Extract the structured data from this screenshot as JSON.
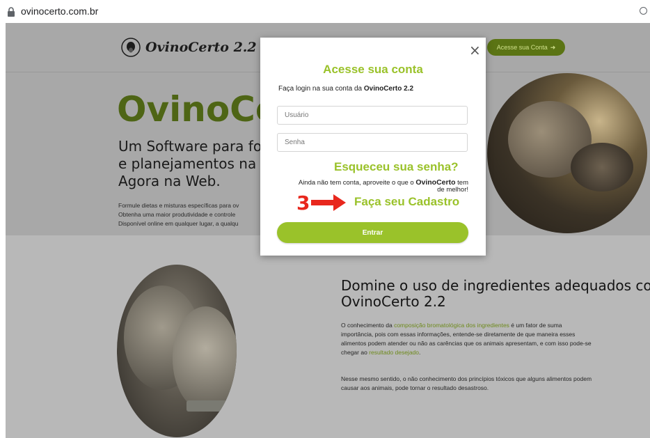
{
  "browser": {
    "url": "ovinocerto.com.br"
  },
  "header": {
    "logo_text": "OvinoCerto 2.2",
    "cta_label": "Acesse sua Conta"
  },
  "hero": {
    "title": "OvinoCer",
    "subtitle_lines": [
      "Um Software para form",
      "e planejamentos na Ovi",
      "Agora na Web."
    ],
    "body_lines": [
      "Formule dietas e misturas específicas para ov",
      "Obtenha uma maior produtividade e controle",
      "Disponível online em qualquer lugar, a qualqu"
    ]
  },
  "section": {
    "title_lines": [
      "Domine o uso de ingredientes adequados com o",
      "OvinoCerto 2.2"
    ],
    "p1_a": "O conhecimento da ",
    "p1_hl1": "composição bromatológica dos ingredientes",
    "p1_b": " é um fator de suma",
    "p1_line2": "importância, pois com essas informações, entende-se diretamente de que maneira esses",
    "p1_line3": "alimentos podem atender ou não as carências que os animais apresentam, e com isso pode-se",
    "p1_c": "chegar ao ",
    "p1_hl2": "resultado desejado",
    "p1_d": ".",
    "p2_lines": [
      "Nesse mesmo sentido, o não conhecimento dos princípios tóxicos que alguns alimentos podem",
      "causar aos animais, pode tornar o resultado desastroso."
    ]
  },
  "modal": {
    "close": "×",
    "title": "Acesse sua conta",
    "login_text": "Faça login na sua conta da ",
    "login_brand": "OvinoCerto 2.2",
    "username_placeholder": "Usuário",
    "password_placeholder": "Senha",
    "forgot": "Esqueceu sua senha?",
    "no_account_a": "Ainda não tem conta, aproveite o que o ",
    "no_account_brand": "OvinoCerto",
    "no_account_b": " tem",
    "no_account_line2": "de melhor!",
    "step_number": "3",
    "register": "Faça seu Cadastro",
    "submit": "Entrar"
  },
  "colors": {
    "accent": "#9ac22a",
    "annotation": "#e8271d"
  }
}
